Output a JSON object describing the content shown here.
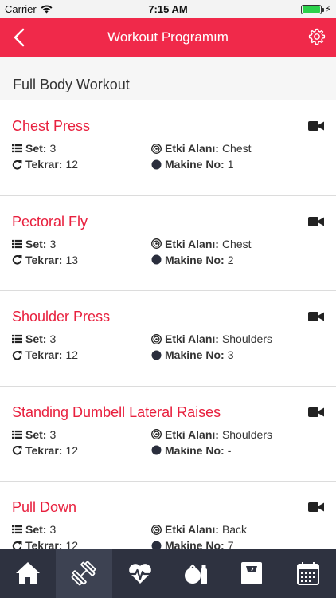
{
  "status_bar": {
    "carrier": "Carrier",
    "time": "7:15 AM"
  },
  "navbar": {
    "title": "Workout Programım",
    "back_icon": "chevron-left-icon",
    "settings_icon": "gear-icon"
  },
  "section": {
    "title": "Full Body Workout"
  },
  "labels": {
    "set": "Set:",
    "reps": "Tekrar:",
    "area": "Etki Alanı:",
    "machine": "Makine No:"
  },
  "workouts": [
    {
      "name": "Chest Press",
      "set": "3",
      "reps": "12",
      "area": "Chest",
      "machine": "1"
    },
    {
      "name": "Pectoral Fly",
      "set": "3",
      "reps": "13",
      "area": "Chest",
      "machine": "2"
    },
    {
      "name": "Shoulder Press",
      "set": "3",
      "reps": "12",
      "area": "Shoulders",
      "machine": "3"
    },
    {
      "name": "Standing Dumbell Lateral Raises",
      "set": "3",
      "reps": "12",
      "area": "Shoulders",
      "machine": "-"
    },
    {
      "name": "Pull Down",
      "set": "3",
      "reps": "12",
      "area": "Back",
      "machine": "7"
    }
  ],
  "tabs": [
    {
      "icon": "home-icon",
      "active": false
    },
    {
      "icon": "dumbbell-icon",
      "active": true
    },
    {
      "icon": "heart-rate-icon",
      "active": false
    },
    {
      "icon": "nutrition-icon",
      "active": false
    },
    {
      "icon": "scale-icon",
      "active": false
    },
    {
      "icon": "calendar-icon",
      "active": false
    }
  ],
  "colors": {
    "accent": "#f0294a",
    "title_red": "#e8203e",
    "tabbar": "#2e3240",
    "tab_active": "#3d4252"
  }
}
